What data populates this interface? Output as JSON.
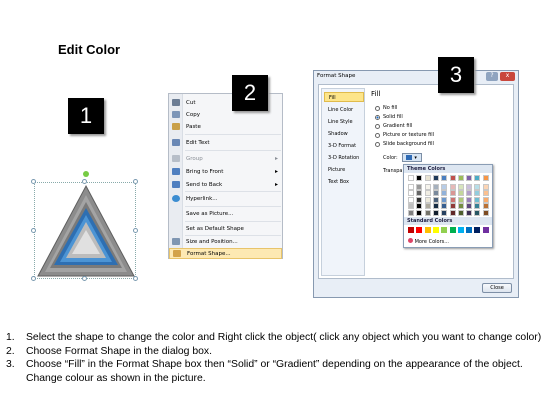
{
  "heading": "Edit Color",
  "badges": [
    "1",
    "2",
    "3"
  ],
  "context_menu": {
    "items": [
      {
        "label": "Cut",
        "icon": "scissors-icon",
        "color": "#6b7c93"
      },
      {
        "label": "Copy",
        "icon": "copy-icon",
        "color": "#7d96b8"
      },
      {
        "label": "Paste",
        "icon": "paste-icon",
        "color": "#c9a04a"
      },
      {
        "label": "Edit Text",
        "icon": "edit-text-icon",
        "color": "#6a88b5"
      },
      {
        "label": "Group",
        "icon": "group-icon",
        "color": "#b7bec8",
        "disabled": true,
        "submenu": true
      },
      {
        "label": "Bring to Front",
        "icon": "bring-front-icon",
        "color": "#4f7fc0",
        "submenu": true
      },
      {
        "label": "Send to Back",
        "icon": "send-back-icon",
        "color": "#4f7fc0",
        "submenu": true
      },
      {
        "label": "Hyperlink...",
        "icon": "globe-icon",
        "color": "#3c8dd1"
      },
      {
        "label": "Save as Picture...",
        "icon": "",
        "color": ""
      },
      {
        "label": "Set as Default Shape",
        "icon": "",
        "color": ""
      },
      {
        "label": "Size and Position...",
        "icon": "size-icon",
        "color": "#7f96b2"
      },
      {
        "label": "Format Shape...",
        "icon": "format-shape-icon",
        "color": "#d3a34a"
      }
    ]
  },
  "dialog": {
    "title": "Format Shape",
    "help": "?",
    "close_x": "x",
    "nav": [
      "Fill",
      "Line Color",
      "Line Style",
      "Shadow",
      "3-D Format",
      "3-D Rotation",
      "Picture",
      "Text Box"
    ],
    "fill_heading": "Fill",
    "options": [
      "No fill",
      "Solid fill",
      "Gradient fill",
      "Picture or texture fill",
      "Slide background fill"
    ],
    "selected_option": "Solid fill",
    "color_label": "Color:",
    "transparency_label": "Transpa",
    "theme_colors_label": "Theme Colors",
    "standard_colors_label": "Standard Colors",
    "more_colors": "More Colors...",
    "close_button": "Close",
    "theme_top_row": [
      "#ffffff",
      "#000000",
      "#e8e3d2",
      "#1f3a5a",
      "#4a7fc0",
      "#c0504d",
      "#9bbb59",
      "#7e5ea7",
      "#4bacc6",
      "#f79646"
    ],
    "standard_colors": [
      "#c00000",
      "#ff0000",
      "#ffc000",
      "#ffff00",
      "#92d050",
      "#00b050",
      "#00b0f0",
      "#0070c0",
      "#002060",
      "#7030a0"
    ]
  },
  "instructions": [
    {
      "num": "1.",
      "text": "Select the shape to change the color and Right click the object( click any object which you want to change color)"
    },
    {
      "num": "2.",
      "text": "Choose Format Shape in the dialog box."
    },
    {
      "num": "3.",
      "text": "Choose “Fill” in the Format Shape box then “Solid” or “Gradient” depending on the appearance of the object. Change colour as shown in the picture."
    }
  ]
}
